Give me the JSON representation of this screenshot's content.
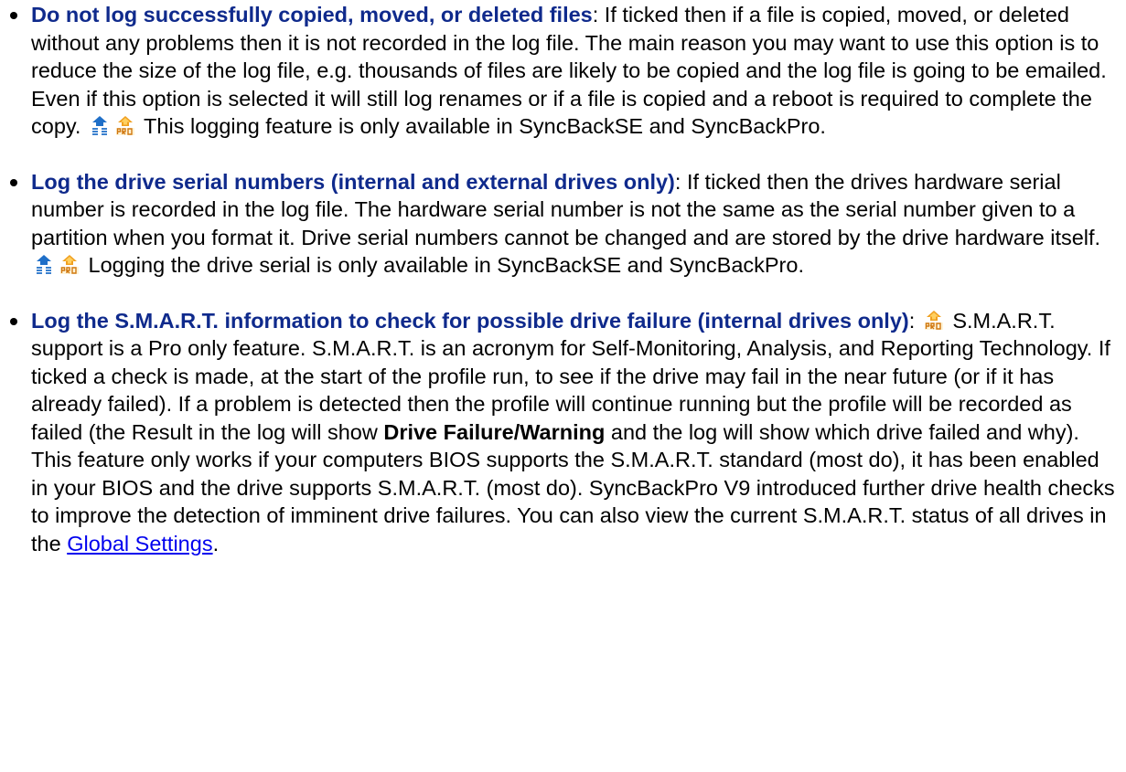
{
  "options": [
    {
      "title": "Do not log successfully copied, moved, or deleted files",
      "sep": ":",
      "text1": " If ticked then if a file is copied, moved, or deleted without any problems then it is not recorded in the log file. The main reason you may want to use this option is to reduce the size of the log file, e.g. thousands of files are likely to be copied and the log file is going to be emailed. Even if this option is selected it will still log renames or if a file is copied and a reboot is required to complete the copy. ",
      "text2": " This logging feature is only available in SyncBackSE and SyncBackPro.",
      "icons": [
        "syncbackse-icon",
        "syncbackpro-icon"
      ]
    },
    {
      "title": "Log the drive serial numbers (internal and external drives only)",
      "sep": ":",
      "text1": " If ticked then the drives hardware serial number is recorded in the log file. The hardware serial number is not the same as the serial number given to a partition when you format it. Drive serial numbers cannot be changed and are stored by the drive hardware itself. ",
      "text2": " Logging the drive serial is only available in SyncBackSE and SyncBackPro.",
      "icons": [
        "syncbackse-icon",
        "syncbackpro-icon"
      ]
    },
    {
      "title": "Log the S.M.A.R.T. information to check for possible drive failure (internal drives only)",
      "sep": ":",
      "text1": " S.M.A.R.T. support is a Pro only feature. S.M.A.R.T. is an acronym for Self-Monitoring, Analysis, and Reporting Technology. If ticked a check is made, at the start of the profile run, to see if the drive may fail in the near future (or if it has already failed). If a problem is detected then the profile will continue running but the profile will be recorded as failed (the Result in the log will show ",
      "bold": "Drive Failure/Warning",
      "text2": " and the log will show which drive failed and why). This feature only works if your computers BIOS supports the S.M.A.R.T. standard (most do), it has been enabled in your BIOS and the drive supports S.M.A.R.T. (most do).  SyncBackPro V9 introduced further drive health checks to improve the detection of imminent drive failures. You can also view the current S.M.A.R.T. status of all drives in the ",
      "link": "Global Settings",
      "text3": ".",
      "icons": [
        "syncbackpro-icon"
      ]
    }
  ],
  "colors": {
    "title": "#0f2a8c",
    "link": "#0000ee",
    "se_icon": "#1f6fc8",
    "pro_icon": "#f0a020"
  }
}
